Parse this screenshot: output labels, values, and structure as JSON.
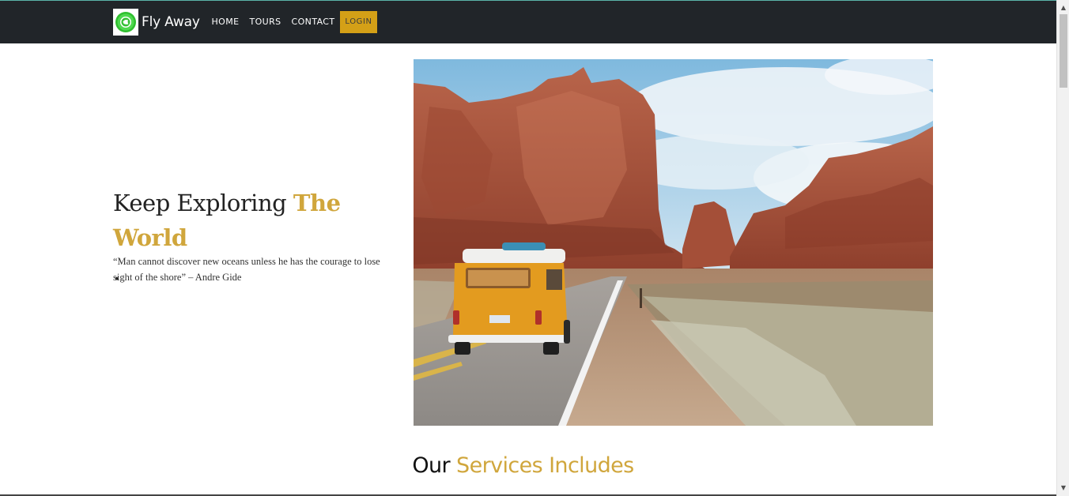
{
  "navbar": {
    "brand_name": "Fly Away",
    "links": [
      "HOME",
      "TOURS",
      "CONTACT"
    ],
    "login_label": "LOGIN"
  },
  "hero": {
    "title_prefix": "Keep Exploring ",
    "title_accent": "The World",
    "title_suffix": ".",
    "quote": "“Man cannot discover new oceans unless he has the courage to lose sight of the shore” – Andre Gide"
  },
  "services": {
    "title_prefix": "Our ",
    "title_accent": "Services Includes"
  },
  "colors": {
    "navbar_bg": "#212529",
    "accent": "#d0a63c",
    "login_bg": "#d4a017"
  },
  "icons": {
    "brand_logo": "globe-logo-icon",
    "scroll_up": "arrow-up-icon",
    "scroll_down": "arrow-down-icon"
  }
}
